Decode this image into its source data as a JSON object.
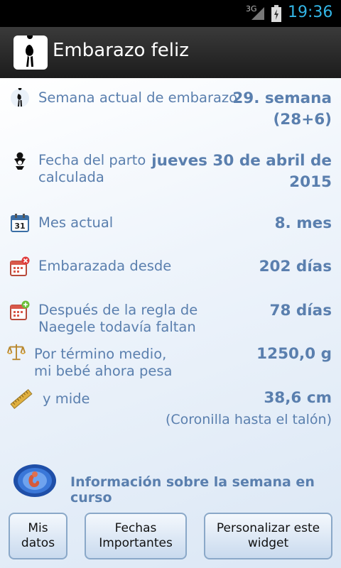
{
  "status_bar": {
    "network": "3G",
    "time": "19:36"
  },
  "app": {
    "title": "Embarazo feliz",
    "icon": "pregnant-silhouette-icon"
  },
  "rows": [
    {
      "icon": "pregnant-silhouette-icon",
      "label": "Semana actual de embarazo",
      "value": "29. semana\n(28+6)"
    },
    {
      "icon": "baby-icon",
      "label": "Fecha del parto\ncalculada",
      "value": "jueves 30 de abril de\n2015"
    },
    {
      "icon": "calendar-icon",
      "label": "Mes actual",
      "value": "8. mes"
    },
    {
      "icon": "calendar-minus-icon",
      "label": "Embarazada desde",
      "value": "202 días"
    },
    {
      "icon": "calendar-plus-icon",
      "label": "Después de la regla de\nNaegele todavía faltan",
      "value": "78 días"
    },
    {
      "icon": "scale-icon",
      "label": "Por término medio,\nmi bebé ahora pesa",
      "value": "1250,0 g"
    },
    {
      "icon": "ruler-icon",
      "label": "y mide",
      "value": "38,6 cm",
      "sub": "(Coronilla hasta el talón)"
    }
  ],
  "info": {
    "icon": "fetus-icon",
    "label": "Información sobre la semana en curso"
  },
  "buttons": {
    "my_data": "Mis datos",
    "important_dates": "Fechas\nImportantes",
    "customize_widget": "Personalizar este\nwidget"
  }
}
